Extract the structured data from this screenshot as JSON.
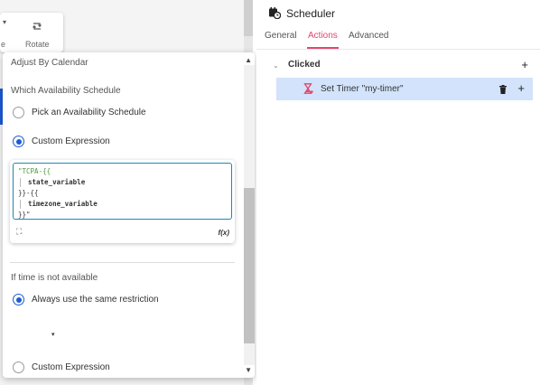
{
  "canvas_toolbar": {
    "dropdown_arrow": "▾",
    "left_label": "e",
    "rotate_label": "Rotate",
    "rotate_icon": "rotate-icon"
  },
  "popup": {
    "section_label": "Adjust By Calendar",
    "availability_heading": "Which Availability Schedule",
    "option_pick": "Pick an Availability Schedule",
    "option_custom": "Custom Expression",
    "selected": "Custom Expression",
    "expression": {
      "line1_open": "\"TCPA-{{",
      "line2_var": "state_variable",
      "line3_mid": "}}-{{",
      "line4_var": "timezone_variable",
      "line5_close": "}}\"",
      "fx_label": "f(x)"
    },
    "not_available_heading": "If time is not available",
    "option_same": "Always use the same restriction",
    "option_custom_2": "Custom Expression",
    "selected_2": "Always use the same restriction",
    "caret": "▾",
    "scroll_up": "▲",
    "scroll_down": "▼"
  },
  "right_panel": {
    "title": "Scheduler",
    "title_icon": "calendar-clock-icon",
    "tabs": [
      {
        "label": "General",
        "active": false
      },
      {
        "label": "Actions",
        "active": true
      },
      {
        "label": "Advanced",
        "active": false
      }
    ],
    "event": {
      "label": "Clicked",
      "caret": "⌄",
      "add": "+"
    },
    "action": {
      "label": "Set Timer \"my-timer\"",
      "icon": "hourglass-icon",
      "add": "+"
    }
  },
  "colors": {
    "accent_blue": "#1b5bd6",
    "tab_active": "#e5456b",
    "row_highlight": "#d2e3fb",
    "expr_border": "#1e88b6"
  }
}
